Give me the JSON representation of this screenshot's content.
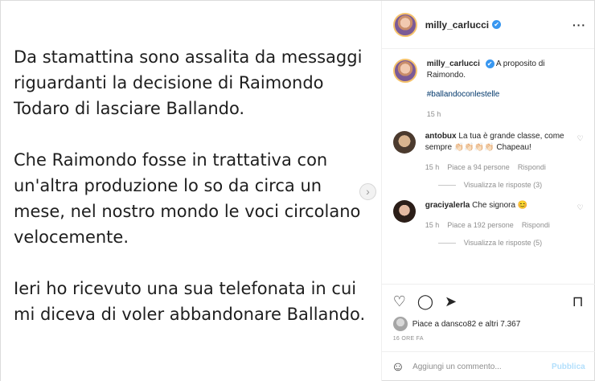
{
  "post_image": {
    "paragraphs": [
      "Da stamattina sono assalita da messaggi riguardanti la decisione di Raimondo Todaro di lasciare Ballando.",
      "Che Raimondo fosse in trattativa con un'altra produzione lo so da circa un mese, nel nostro mondo le voci circolano velocemente.",
      "Ieri ho ricevuto una sua telefonata in cui mi diceva di voler abbandonare Ballando."
    ],
    "next_arrow": "›"
  },
  "header": {
    "username": "milly_carlucci",
    "verified_mark": "✔",
    "more": "···"
  },
  "caption": {
    "username": "milly_carlucci",
    "verified_mark": "✔",
    "text": "A proposito di Raimondo.",
    "hashtag": "#ballandoconlestelle",
    "time": "15 h"
  },
  "comments": [
    {
      "username": "antobux",
      "text": "La tua è grande classe, come sempre 👏🏻👏🏻👏🏻👏🏻 Chapeau!",
      "time": "15 h",
      "likes": "Piace a 94 persone",
      "reply": "Rispondi",
      "view_replies": "Visualizza le risposte (3)"
    },
    {
      "username": "graciyalerla",
      "text": "Che signora 😊",
      "time": "15 h",
      "likes": "Piace a 192 persone",
      "reply": "Rispondi",
      "view_replies": "Visualizza le risposte (5)"
    }
  ],
  "actions": {
    "like_icon": "heart-icon",
    "comment_icon": "comment-icon",
    "share_icon": "share-icon",
    "save_icon": "bookmark-icon",
    "liked_by": "Piace a dansco82 e altri 7.367",
    "timestamp": "16 ORE FA"
  },
  "composer": {
    "placeholder": "Aggiungi un commento...",
    "publish": "Pubblica"
  },
  "colors": {
    "link": "#00376b",
    "verified": "#3897f0",
    "publish_disabled": "#b2dffc",
    "muted": "#8e8e8e"
  }
}
